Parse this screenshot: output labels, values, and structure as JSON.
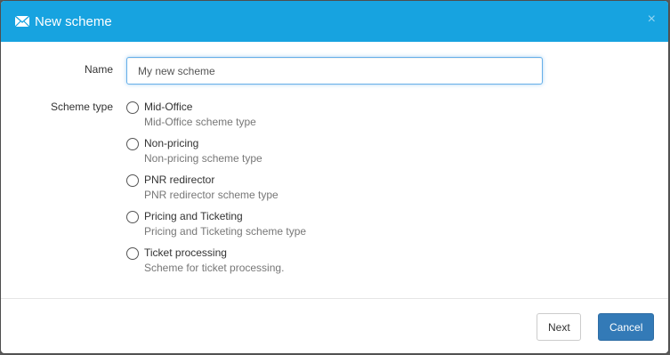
{
  "dialog": {
    "title": "New scheme",
    "icon": "envelope-icon",
    "close_symbol": "×",
    "header_color": "#17a3e0"
  },
  "form": {
    "name_label": "Name",
    "name_value": "My new scheme",
    "scheme_type_label": "Scheme type",
    "options": [
      {
        "label": "Mid-Office",
        "description": "Mid-Office scheme type"
      },
      {
        "label": "Non-pricing",
        "description": "Non-pricing scheme type"
      },
      {
        "label": "PNR redirector",
        "description": "PNR redirector scheme type"
      },
      {
        "label": "Pricing and Ticketing",
        "description": "Pricing and Ticketing scheme type"
      },
      {
        "label": "Ticket processing",
        "description": "Scheme for ticket processing."
      }
    ]
  },
  "footer": {
    "next_label": "Next",
    "cancel_label": "Cancel",
    "cancel_color": "#337ab7"
  }
}
